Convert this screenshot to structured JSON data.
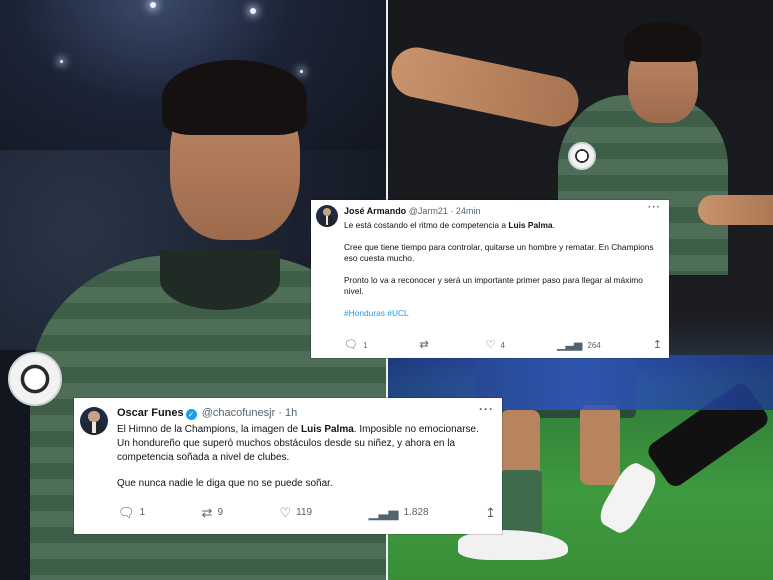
{
  "tweets": [
    {
      "author": "José Armando",
      "handle": "@Jarm21",
      "time": "· 24min",
      "paragraphs": [
        {
          "pre": "Le está costando el ritmo de competencia a ",
          "bold": "Luis Palma",
          "post": "."
        },
        {
          "pre": "Cree que tiene tiempo para controlar, quitarse un hombre y rematar. En Champions eso cuesta mucho.",
          "bold": "",
          "post": ""
        },
        {
          "pre": "Pronto lo va a reconocer y será un importante primer paso para llegar al máximo nivel.",
          "bold": "",
          "post": ""
        }
      ],
      "hashtags": "#Honduras #UCL",
      "replies": "1",
      "retweets": "",
      "likes": "4",
      "views": "264"
    },
    {
      "author": "Oscar Funes",
      "handle": "@chacofunesjr",
      "time": "· 1h",
      "paragraphs": [
        {
          "pre": "El Himno de la Champions, la imagen de ",
          "bold": "Luis Palma",
          "post": ". Imposible no emocionarse. Un hondureño que superó muchos obstáculos desde su niñez, y ahora en la competencia soñada a nivel de clubes."
        },
        {
          "pre": "Que nunca nadie le diga que no se puede soñar.",
          "bold": "",
          "post": ""
        }
      ],
      "replies": "1",
      "retweets": "9",
      "likes": "119",
      "views": "1.828"
    }
  ],
  "icons": {
    "more": "more-icon",
    "reply": "reply-icon",
    "retweet": "retweet-icon",
    "like": "like-icon",
    "views": "views-icon",
    "share": "share-icon",
    "verified": "verified-icon"
  },
  "colors": {
    "link": "#1d9bf0",
    "muted": "#536471",
    "text": "#0f1419",
    "card": "#ffffff"
  }
}
